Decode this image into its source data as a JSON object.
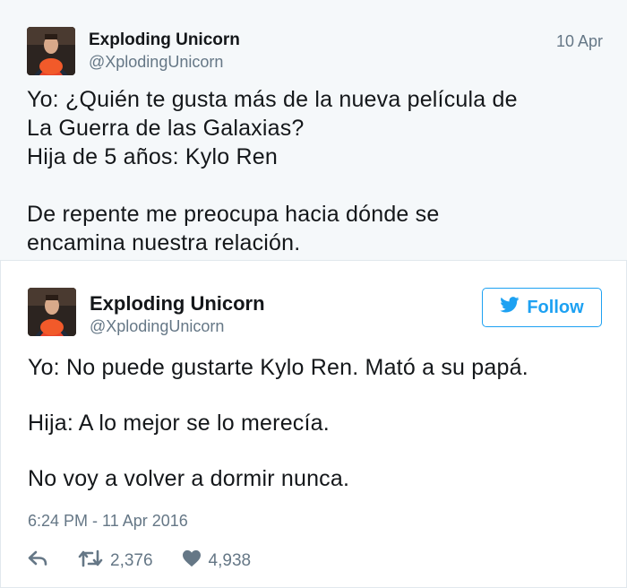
{
  "tweets": [
    {
      "author_name": "Exploding Unicorn",
      "author_handle": "@XplodingUnicorn",
      "date": "10 Apr",
      "text": "Yo: ¿Quién te gusta más de la nueva película de\nLa Guerra de las Galaxias?\nHija de 5 años: Kylo Ren\n\nDe repente me preocupa hacia dónde se\nencamina nuestra relación."
    },
    {
      "author_name": "Exploding Unicorn",
      "author_handle": "@XplodingUnicorn",
      "follow_label": "Follow",
      "text": "Yo: No puede gustarte Kylo Ren. Mató a su papá.\n\nHija: A lo mejor se lo merecía.\n\nNo voy a volver a dormir nunca.",
      "timestamp": "6:24 PM - 11 Apr 2016",
      "retweets": "2,376",
      "likes": "4,938"
    }
  ],
  "icons": {
    "reply": "reply-icon",
    "retweet": "retweet-icon",
    "like": "heart-icon",
    "follow": "twitter-bird-icon"
  },
  "colors": {
    "accent": "#1da1f2",
    "secondary_text": "#657786",
    "first_tweet_bg": "#f5f8fa"
  }
}
